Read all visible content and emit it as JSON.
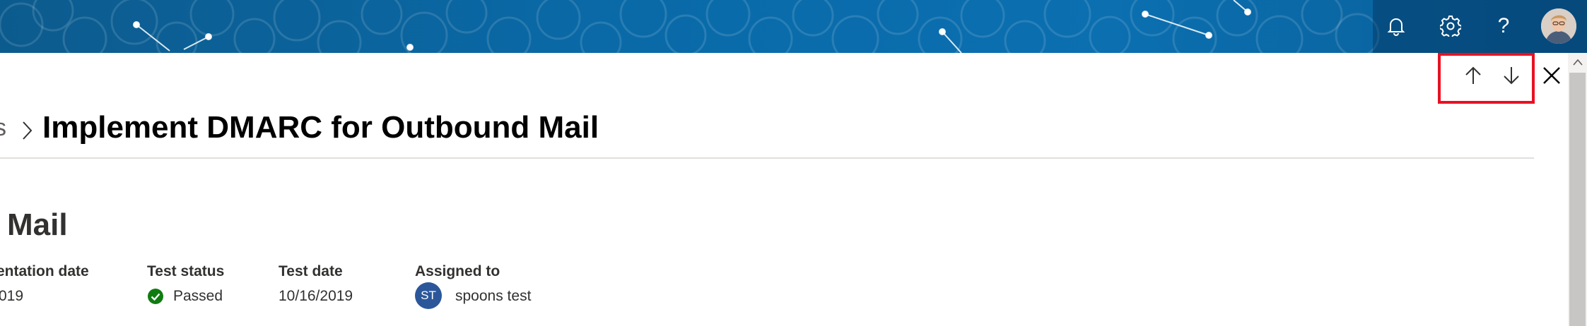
{
  "header": {
    "notifications_icon": "bell-icon",
    "settings_icon": "gear-icon",
    "help_label": "?",
    "avatar_icon": "user-photo"
  },
  "nav": {
    "prev_icon": "arrow-up-icon",
    "next_icon": "arrow-down-icon",
    "close_icon": "close-icon",
    "highlight_color": "#e81123"
  },
  "breadcrumb": {
    "previous_label": "s",
    "current_title": "Implement DMARC for Outbound Mail"
  },
  "detail": {
    "heading": "Mail",
    "fields": [
      {
        "label": "entation date",
        "value": "019"
      },
      {
        "label": "Test status",
        "value": "Passed",
        "status_color": "#107c10"
      },
      {
        "label": "Test date",
        "value": "10/16/2019"
      },
      {
        "label": "Assigned to",
        "initials": "ST",
        "value": "spoons test",
        "avatar_color": "#2b579a"
      }
    ]
  },
  "colors": {
    "banner": "#0b6aa8",
    "text": "#323130",
    "divider": "#e1dfdd"
  }
}
